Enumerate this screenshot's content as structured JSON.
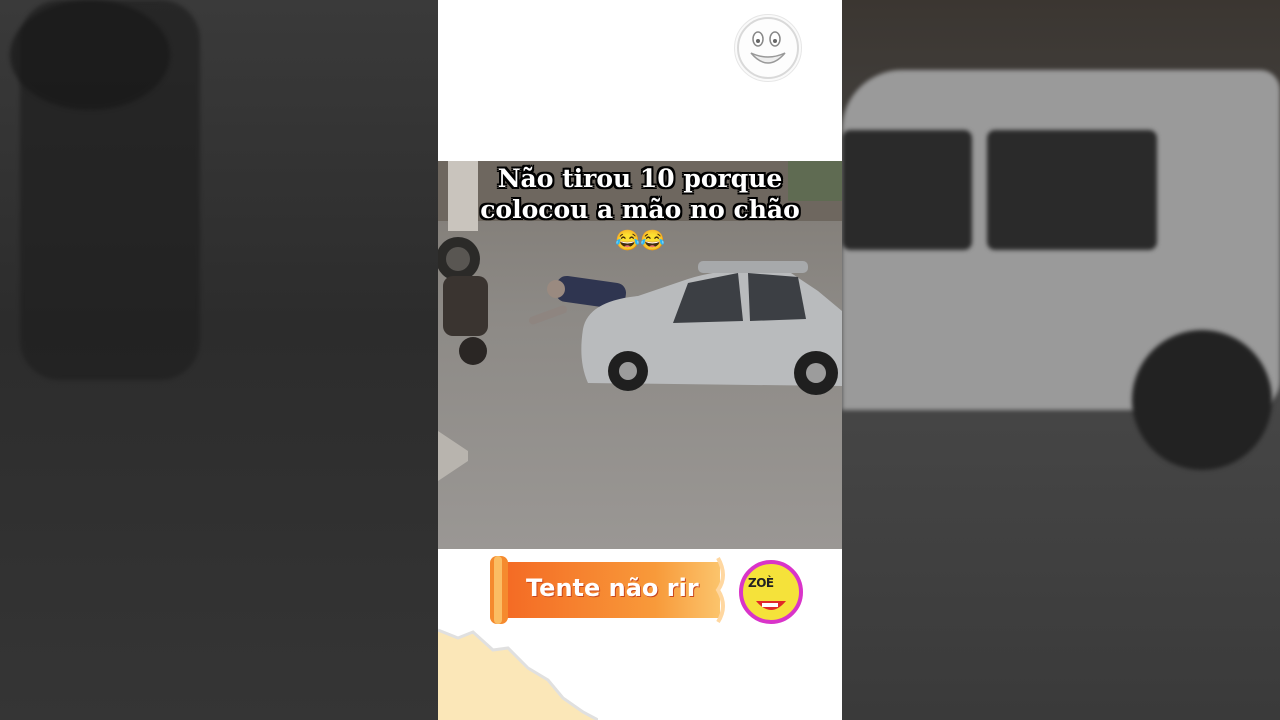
{
  "caption": {
    "line1": "Não tirou 10 porque",
    "line2": "colocou a mão no chão",
    "emoji": "😂😂"
  },
  "banner": {
    "text": "Tente não rir"
  },
  "brand": {
    "text": "ZOÈ"
  },
  "colors": {
    "banner_orange": "#f47a2a",
    "banner_light": "#f9a54a",
    "car_silver": "#b9bbbd",
    "road_gray": "#8f8c88"
  },
  "icons": [
    "smiley-face-icon",
    "laughing-face-icon"
  ]
}
